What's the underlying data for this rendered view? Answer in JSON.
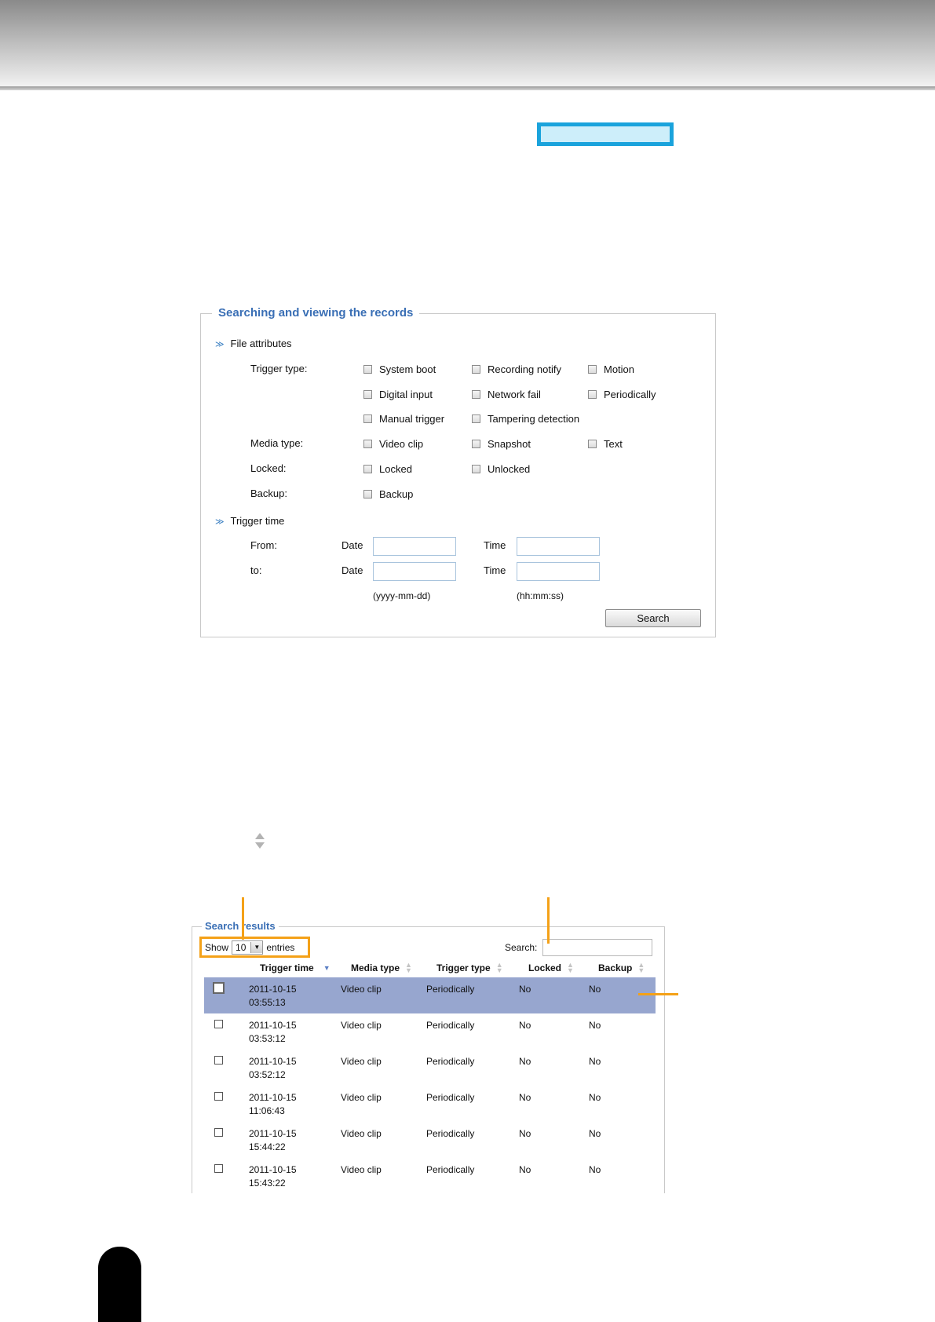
{
  "search_panel": {
    "title": "Searching and viewing the records",
    "file_attributes_label": "File attributes",
    "trigger_type_label": "Trigger type:",
    "trigger_types": [
      "System boot",
      "Recording notify",
      "Motion",
      "Digital input",
      "Network fail",
      "Periodically",
      "Manual trigger",
      "Tampering detection"
    ],
    "media_type_label": "Media type:",
    "media_types": [
      "Video clip",
      "Snapshot",
      "Text"
    ],
    "locked_label": "Locked:",
    "locked_options": [
      "Locked",
      "Unlocked"
    ],
    "backup_label": "Backup:",
    "backup_options": [
      "Backup"
    ],
    "trigger_time_label": "Trigger time",
    "from_label": "From:",
    "to_label": "to:",
    "date_label": "Date",
    "time_label": "Time",
    "date_format": "(yyyy-mm-dd)",
    "time_format": "(hh:mm:ss)",
    "search_button": "Search"
  },
  "results": {
    "title": "Search results",
    "show_label": "Show",
    "show_value": "10",
    "entries_label": "entries",
    "search_label": "Search:",
    "columns": [
      "Trigger time",
      "Media type",
      "Trigger type",
      "Locked",
      "Backup"
    ],
    "sorted_column": "Trigger time",
    "rows": [
      {
        "date": "2011-10-15",
        "time": "03:55:13",
        "media": "Video clip",
        "trigger": "Periodically",
        "locked": "No",
        "backup": "No",
        "selected": true
      },
      {
        "date": "2011-10-15",
        "time": "03:53:12",
        "media": "Video clip",
        "trigger": "Periodically",
        "locked": "No",
        "backup": "No",
        "selected": false
      },
      {
        "date": "2011-10-15",
        "time": "03:52:12",
        "media": "Video clip",
        "trigger": "Periodically",
        "locked": "No",
        "backup": "No",
        "selected": false
      },
      {
        "date": "2011-10-15",
        "time": "11:06:43",
        "media": "Video clip",
        "trigger": "Periodically",
        "locked": "No",
        "backup": "No",
        "selected": false
      },
      {
        "date": "2011-10-15",
        "time": "15:44:22",
        "media": "Video clip",
        "trigger": "Periodically",
        "locked": "No",
        "backup": "No",
        "selected": false
      },
      {
        "date": "2011-10-15",
        "time": "15:43:22",
        "media": "Video clip",
        "trigger": "Periodically",
        "locked": "No",
        "backup": "No",
        "selected": false
      }
    ]
  },
  "colors": {
    "accent_blue": "#3a6fb5",
    "highlight_cyan": "#1aa3dc",
    "callout_orange": "#f4a118",
    "selected_row": "#97a6cf"
  },
  "icons": {
    "section_toggle": "double-chevron-down-icon",
    "sort": "sort-arrows-icon",
    "dropdown": "dropdown-arrow-icon"
  }
}
